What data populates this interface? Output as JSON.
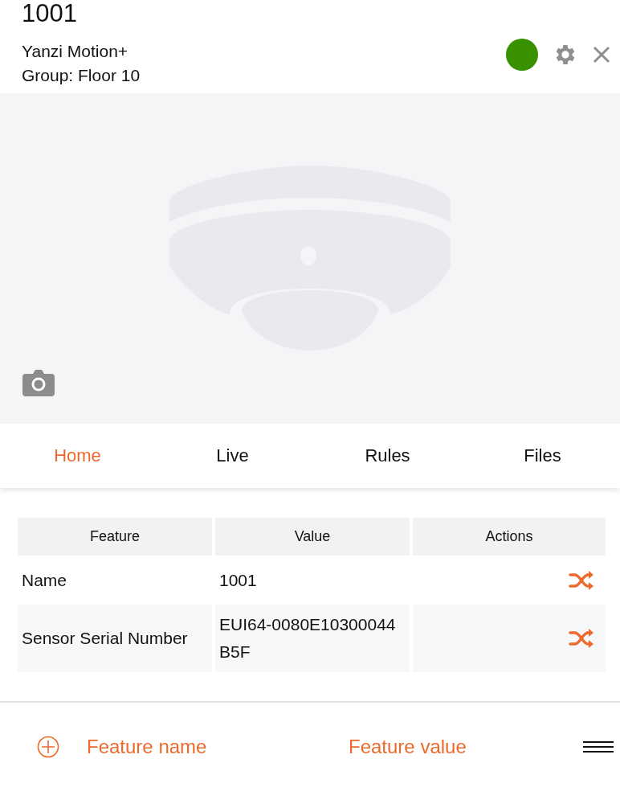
{
  "header": {
    "title": "1001",
    "subtitle": "Yanzi Motion+",
    "group": "Group: Floor 10",
    "online": true
  },
  "tabs": [
    {
      "label": "Home",
      "selected": true
    },
    {
      "label": "Live",
      "selected": false
    },
    {
      "label": "Rules",
      "selected": false
    },
    {
      "label": "Files",
      "selected": false
    }
  ],
  "table": {
    "columns": [
      "Feature",
      "Value",
      "Actions"
    ],
    "rows": [
      {
        "feature": "Name",
        "value": "1001"
      },
      {
        "feature": "Sensor Serial Number",
        "value": "EUI64-0080E10300044B5F"
      }
    ]
  },
  "new_feature": {
    "name_placeholder": "Feature name",
    "value_placeholder": "Feature value"
  }
}
